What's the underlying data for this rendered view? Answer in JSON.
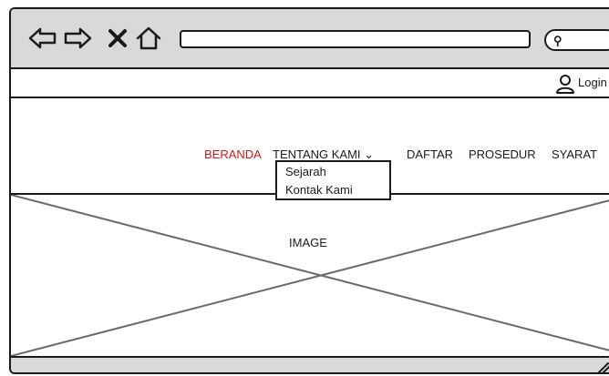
{
  "browser": {
    "icons": [
      "back-arrow-icon",
      "forward-arrow-icon",
      "close-icon",
      "home-icon",
      "search-icon"
    ]
  },
  "header": {
    "login_label": "Login"
  },
  "nav": {
    "items": [
      {
        "label": "BERANDA",
        "active": true
      },
      {
        "label": "TENTANG KAMI ⌄",
        "active": false
      },
      {
        "label": "DAFTAR",
        "active": false
      },
      {
        "label": "PROSEDUR",
        "active": false
      },
      {
        "label": "SYARAT",
        "active": false
      }
    ],
    "dropdown": [
      "Sejarah",
      "Kontak Kami"
    ]
  },
  "hero": {
    "label": "IMAGE"
  },
  "colors": {
    "active": "#d01818",
    "chrome": "#d9d9d9",
    "ink": "#1a1a1a"
  }
}
